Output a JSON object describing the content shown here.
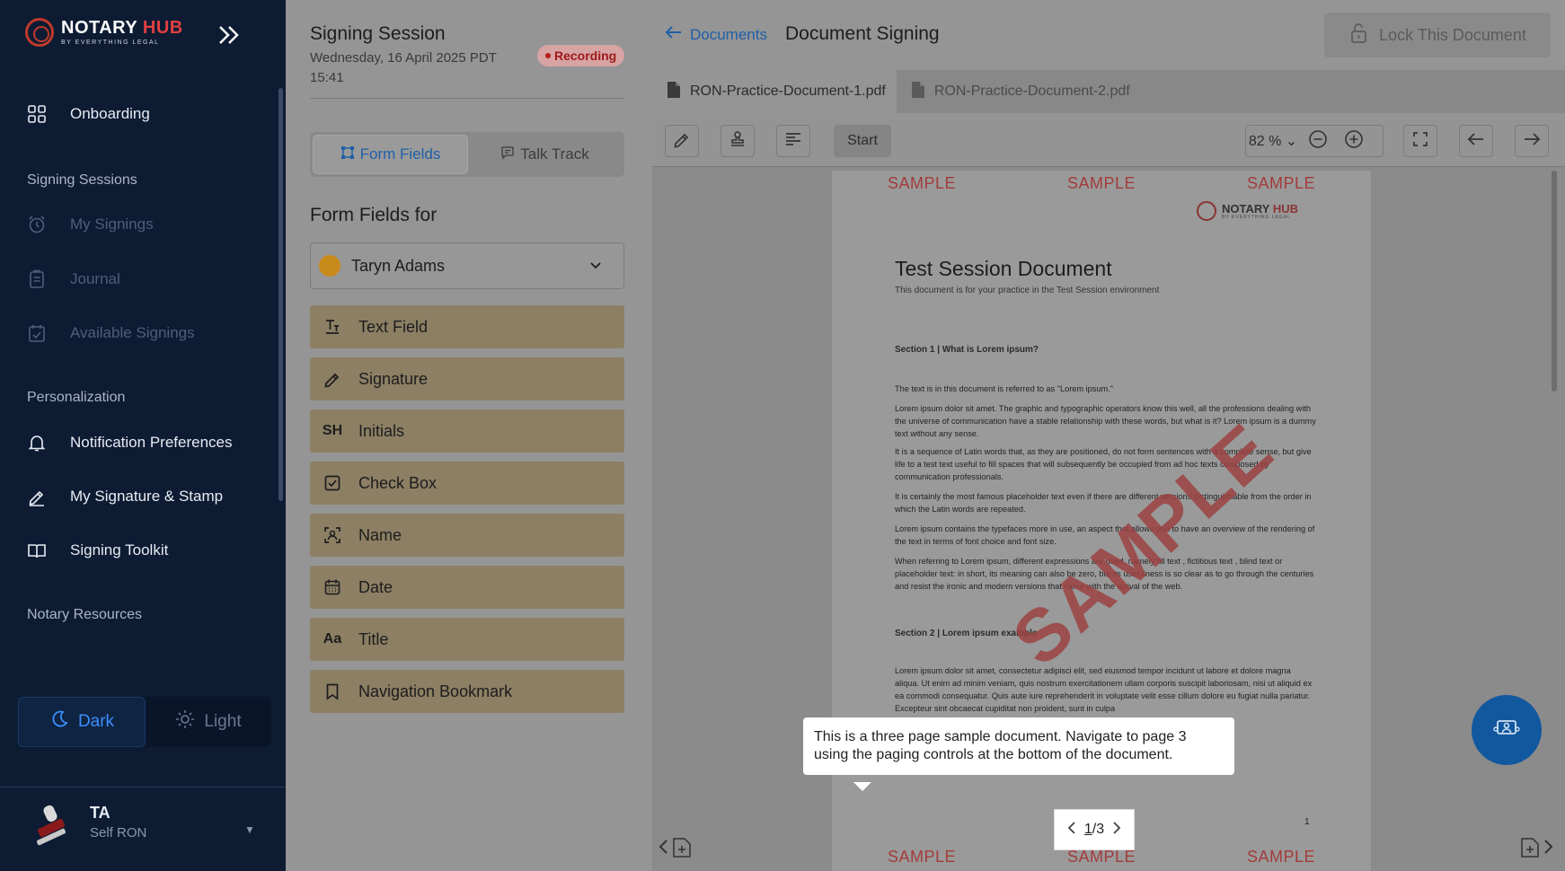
{
  "sidebar": {
    "brand_name": "NOTARY",
    "brand_hub": "HUB",
    "brand_tagline": "BY EVERYTHING LEGAL",
    "items": {
      "onboarding": "Onboarding",
      "section_signing": "Signing Sessions",
      "my_signings": "My Signings",
      "journal": "Journal",
      "available": "Available Signings",
      "section_personal": "Personalization",
      "notifications": "Notification Preferences",
      "signature_stamp": "My Signature & Stamp",
      "toolkit": "Signing Toolkit",
      "section_resources": "Notary Resources"
    },
    "theme": {
      "dark": "Dark",
      "light": "Light",
      "selected": "Dark"
    },
    "user": {
      "initials": "TA",
      "role": "Self RON"
    }
  },
  "session": {
    "title": "Signing Session",
    "date": "Wednesday, 16 April 2025   PDT 15:41",
    "recording": "Recording",
    "tabs": {
      "form_fields": "Form Fields",
      "talk_track": "Talk Track",
      "active": "Form Fields"
    },
    "form_heading": "Form Fields for",
    "signer": "Taryn Adams",
    "signer_color": "#c88a1a",
    "fields": {
      "text": "Text Field",
      "signature": "Signature",
      "initials": "Initials",
      "initials_glyph": "SH",
      "checkbox": "Check Box",
      "name": "Name",
      "date": "Date",
      "title": "Title",
      "title_glyph": "Aa",
      "bookmark": "Navigation Bookmark"
    }
  },
  "main": {
    "back_label": "Documents",
    "title": "Document Signing",
    "lock_label": "Lock This Document",
    "doc_tabs": [
      "RON-Practice-Document-1.pdf",
      "RON-Practice-Document-2.pdf"
    ],
    "start_label": "Start",
    "zoom": "82 %",
    "accent": "#1f5fa8"
  },
  "document": {
    "sample": "SAMPLE",
    "logo_name": "NOTARY",
    "logo_hub": "HUB",
    "logo_tag": "BY EVERYTHING LEGAL",
    "title": "Test Session Document",
    "subtitle": "This document is for your practice in the Test Session environment",
    "section1": "Section 1 | What is Lorem ipsum?",
    "p1": "The text is in this document is referred to as \"Lorem ipsum.\"",
    "p2": "Lorem ipsum dolor sit amet. The graphic and typographic operators know this well, all the professions dealing with the universe of communication have a stable relationship with these words, but what is it? Lorem ipsum is a dummy text without any sense.",
    "p3": "It is a sequence of Latin words that, as they are positioned, do not form sentences with a complete sense, but give life to a test text useful to fill spaces that will subsequently be occupied from ad hoc texts composed by communication professionals.",
    "p4": "It is certainly the most famous placeholder text even if there are different versions distinguishable from the order in which the Latin words are repeated.",
    "p5": "Lorem ipsum contains the typefaces more in use, an aspect that allows you to have an overview of the rendering of the text in terms of font choice and font size.",
    "p6": "When referring to Lorem ipsum, different expressions are used, namely fill text , fictitious text , blind text or placeholder text: in short, its meaning can also be zero, but its usefulness is so clear as to go through the centuries and resist the ironic and modern versions that came with the arrival of the web.",
    "section2": "Section 2 | Lorem ipsum example",
    "p7": "Lorem ipsum dolor sit amet, consectetur adipisci elit, sed eiusmod tempor incidunt ut labore et dolore magna aliqua. Ut enim ad minim veniam, quis nostrum exercitationem ullam corporis suscipit laboriosam, nisi ut aliquid ex ea commodi consequatur. Quis aute iure reprehenderit in voluptate velit esse cillum dolore eu fugiat nulla pariatur. Excepteur sint obcaecat cupiditat non proident, sunt in culpa",
    "page_number": "1",
    "watermark": "SAMPLE"
  },
  "tooltip": "This is a three page sample document. Navigate to page 3 using the paging controls at the bottom of the document.",
  "pager": {
    "current": "1",
    "sep": "/",
    "total": "3"
  }
}
